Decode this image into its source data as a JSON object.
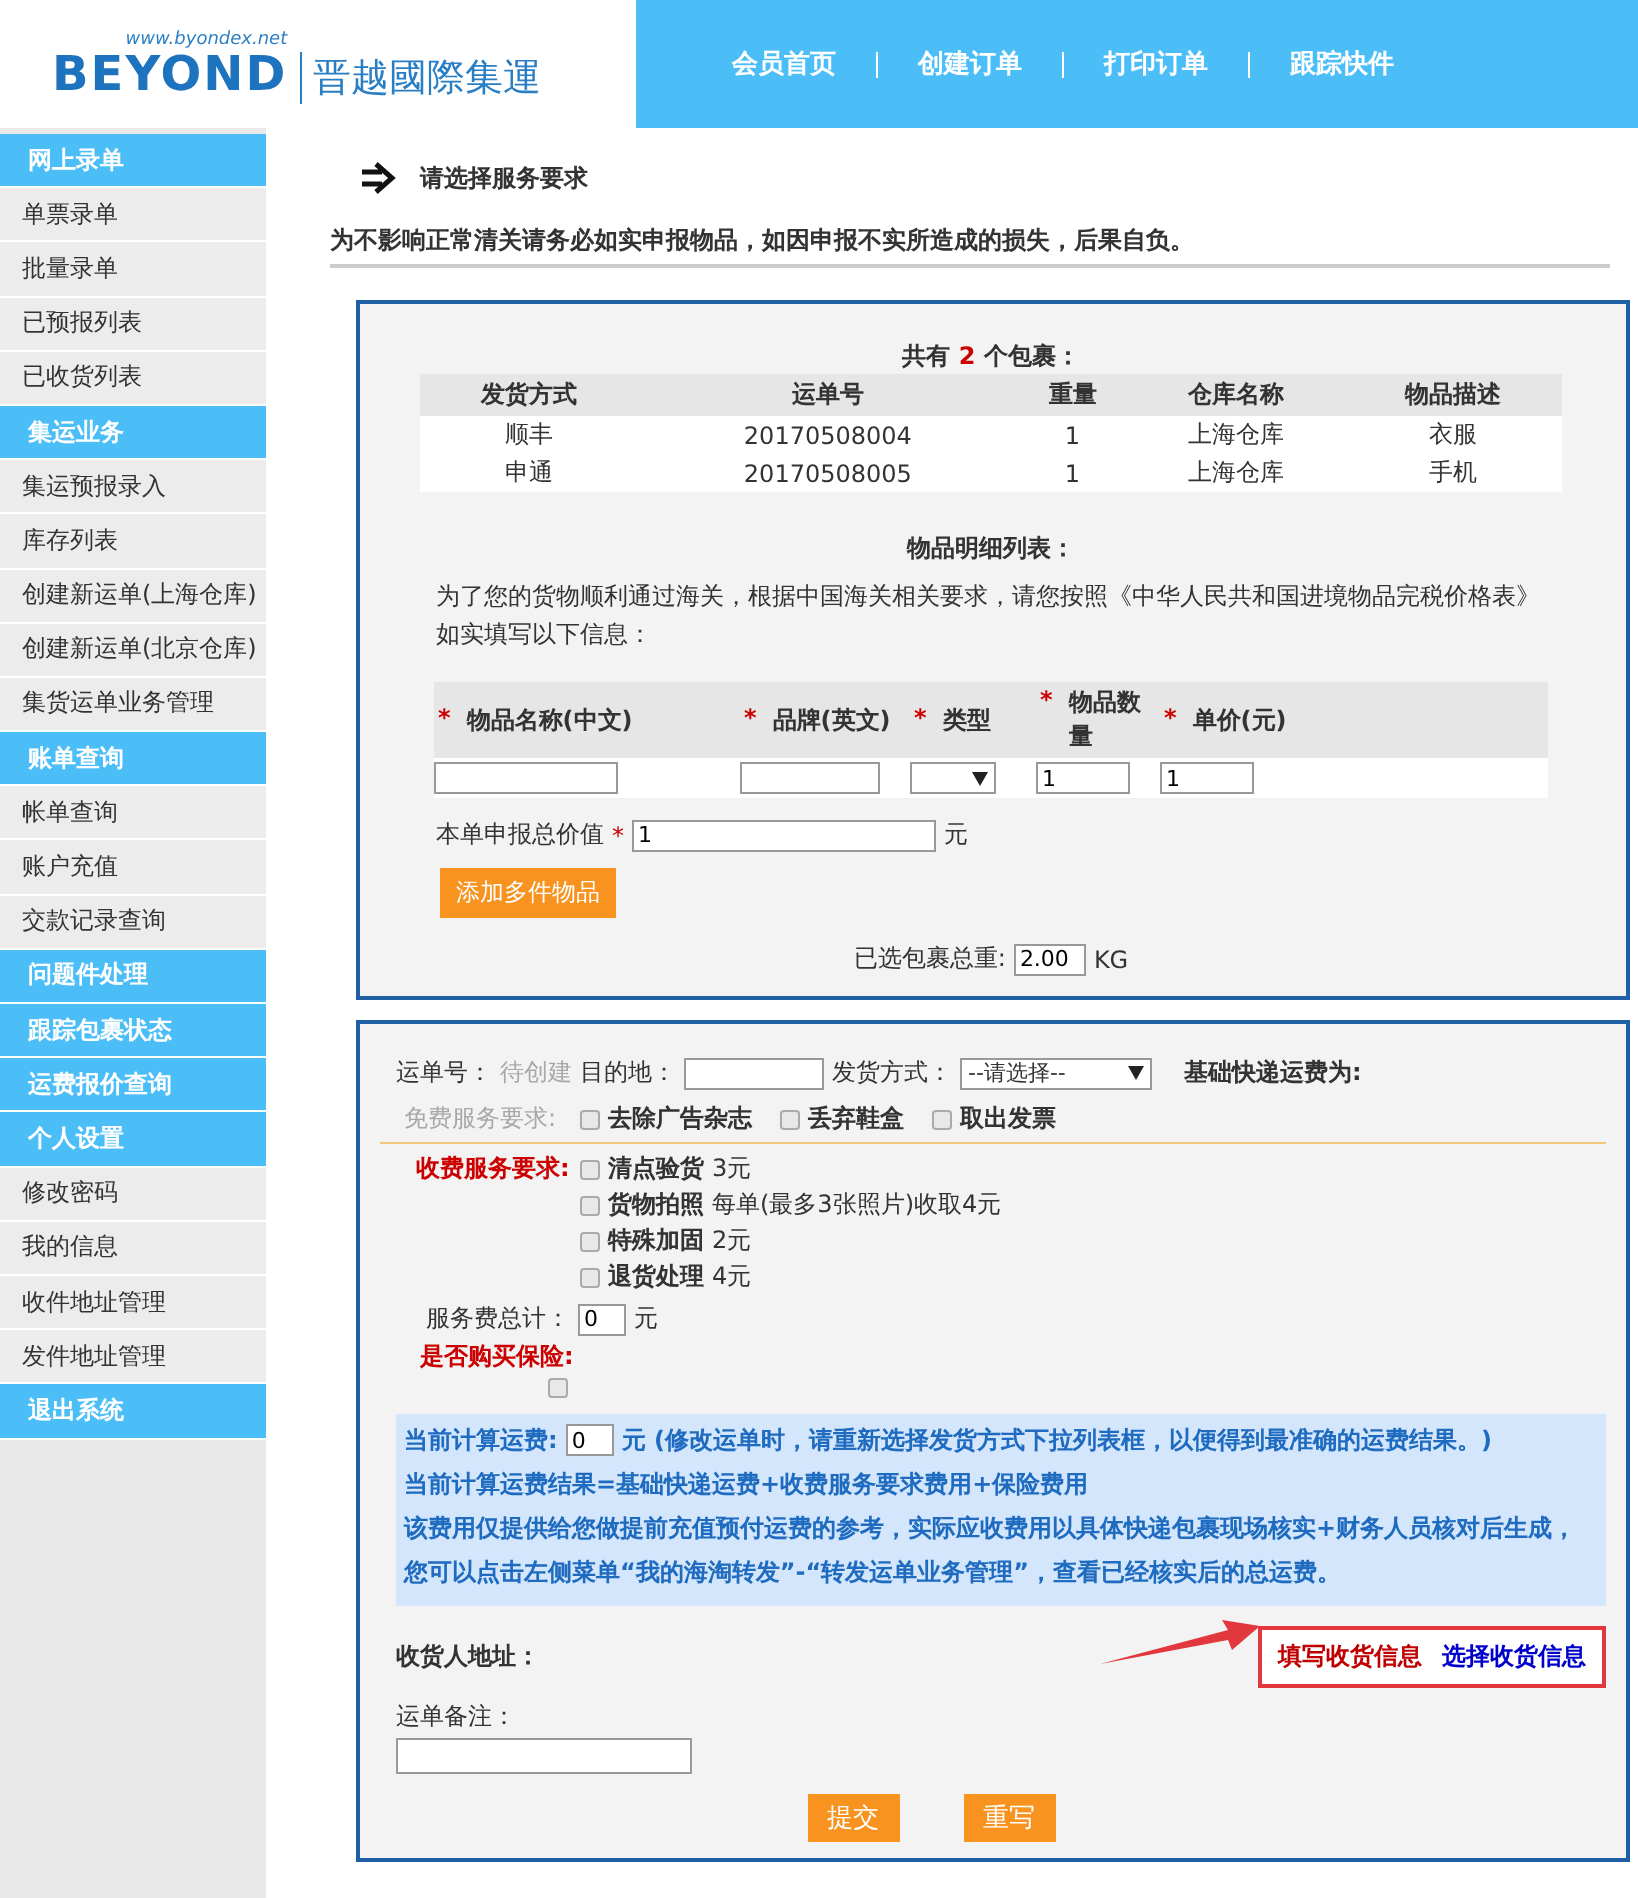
{
  "header": {
    "logo": {
      "url": "www.byondex.net",
      "brand": "BEYOND",
      "name": "晋越國際集運"
    },
    "nav": [
      "会员首页",
      "创建订单",
      "打印订单",
      "跟踪快件"
    ]
  },
  "sidebar": {
    "items": [
      {
        "kind": "header",
        "label": "网上录单"
      },
      {
        "kind": "link",
        "label": "单票录单"
      },
      {
        "kind": "link",
        "label": "批量录单"
      },
      {
        "kind": "link",
        "label": "已预报列表"
      },
      {
        "kind": "link",
        "label": "已收货列表"
      },
      {
        "kind": "header",
        "label": "集运业务"
      },
      {
        "kind": "link",
        "label": "集运预报录入"
      },
      {
        "kind": "link",
        "label": "库存列表"
      },
      {
        "kind": "link",
        "label": "创建新运单(上海仓库)"
      },
      {
        "kind": "link",
        "label": "创建新运单(北京仓库)"
      },
      {
        "kind": "link",
        "label": "集货运单业务管理"
      },
      {
        "kind": "header",
        "label": "账单查询"
      },
      {
        "kind": "link",
        "label": "帐单查询"
      },
      {
        "kind": "link",
        "label": "账户充值"
      },
      {
        "kind": "link",
        "label": "交款记录查询"
      },
      {
        "kind": "header",
        "label": "问题件处理"
      },
      {
        "kind": "header",
        "label": "跟踪包裹状态"
      },
      {
        "kind": "header",
        "label": "运费报价查询"
      },
      {
        "kind": "header",
        "label": "个人设置"
      },
      {
        "kind": "link",
        "label": "修改密码"
      },
      {
        "kind": "link",
        "label": "我的信息"
      },
      {
        "kind": "link",
        "label": "收件地址管理"
      },
      {
        "kind": "link",
        "label": "发件地址管理"
      },
      {
        "kind": "header",
        "label": "退出系统"
      }
    ]
  },
  "page_title": "请选择服务要求",
  "notice": "为不影响正常清关请务必如实申报物品，如因申报不实所造成的损失，后果自负。",
  "packages": {
    "summary_prefix": "共有",
    "count": "2",
    "summary_suffix": "个包裹：",
    "columns": [
      "发货方式",
      "运单号",
      "重量",
      "仓库名称",
      "物品描述"
    ],
    "rows": [
      [
        "顺丰",
        "20170508004",
        "1",
        "上海仓库",
        "衣服"
      ],
      [
        "申通",
        "20170508005",
        "1",
        "上海仓库",
        "手机"
      ]
    ]
  },
  "items": {
    "title": "物品明细列表：",
    "intro": "为了您的货物顺利通过海关，根据中国海关相关要求，请您按照《中华人民共和国进境物品完税价格表》如实填写以下信息：",
    "columns": [
      "物品名称(中文)",
      "品牌(英文)",
      "类型",
      "物品数量",
      "单价(元)"
    ],
    "required_mark": "*",
    "quantity": "1",
    "price": "1",
    "declared_label": "本单申报总价值",
    "declared_value": "1",
    "unit": "元",
    "add_button": "添加多件物品",
    "weight_label": "已选包裹总重:",
    "weight_value": "2.00",
    "weight_unit": "KG"
  },
  "order": {
    "waybill_label": "运单号：",
    "waybill_value": "待创建",
    "dest_label": "目的地：",
    "ship_label": "发货方式：",
    "ship_select": "--请选择--",
    "base_fee_label": "基础快递运费为:",
    "free_label": "免费服务要求:",
    "free_options": [
      {
        "label": "去除广告杂志",
        "checked": false
      },
      {
        "label": "丢弃鞋盒",
        "checked": false
      },
      {
        "label": "取出发票",
        "checked": false
      }
    ],
    "paid_label": "收费服务要求:",
    "paid_options": [
      {
        "label": "清点验货",
        "price": "3元",
        "checked": false
      },
      {
        "label": "货物拍照",
        "price": "每单(最多3张照片)收取4元",
        "checked": false
      },
      {
        "label": "特殊加固",
        "price": "2元",
        "checked": false
      },
      {
        "label": "退货处理",
        "price": "4元",
        "checked": false
      }
    ],
    "service_total_label": "服务费总计：",
    "service_total": "0",
    "unit": "元",
    "insurance_label": "是否购买保险:",
    "insurance_checked": false,
    "fee_label": "当前计算运费:",
    "fee_value": "0",
    "fee_note": "元 (修改运单时，请重新选择发货方式下拉列表框，以便得到最准确的运费结果。)",
    "formula": "当前计算运费结果=基础快递运费+收费服务要求费用+保险费用",
    "disclaimer": "该费用仅提供给您做提前充值预付运费的参考，实际应收费用以具体快递包裹现场核实+财务人员核对后生成，您可以点击左侧菜单“我的海淘转发”-“转发运单业务管理”，查看已经核实后的总运费。",
    "consignee_label": "收货人地址：",
    "address_links": [
      {
        "label": "填写收货信息",
        "color": "#c00000"
      },
      {
        "label": "选择收货信息",
        "color": "#0000cc"
      }
    ],
    "remark_label": "运单备注：",
    "buttons": [
      "提交",
      "重写"
    ]
  }
}
